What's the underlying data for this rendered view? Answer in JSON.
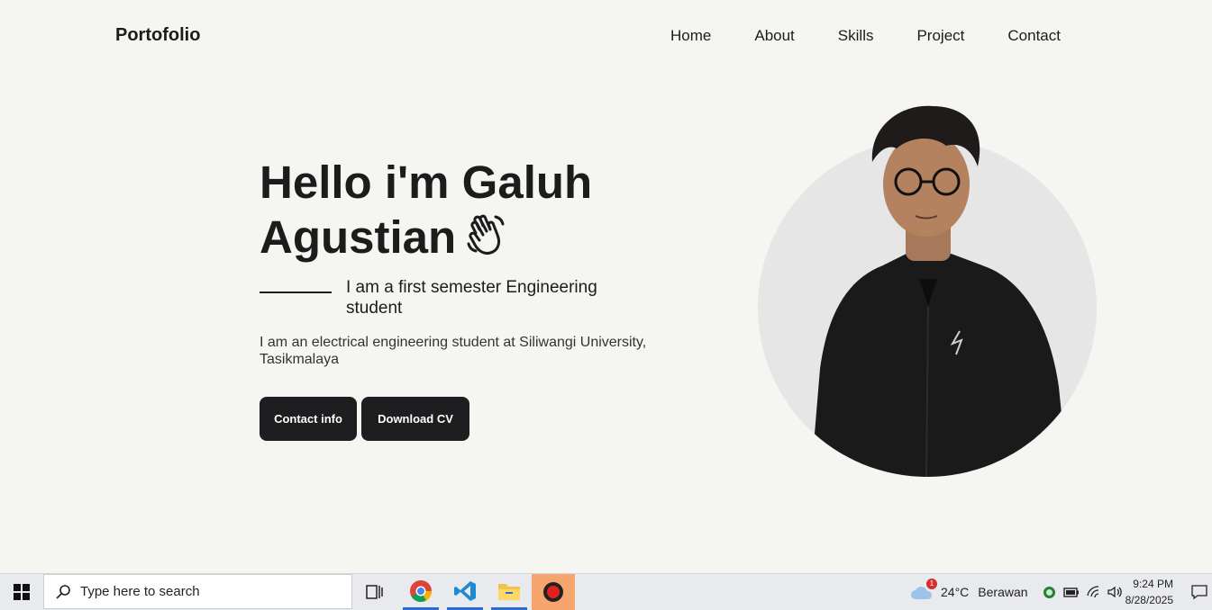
{
  "header": {
    "brand": "Portofolio",
    "nav": [
      "Home",
      "About",
      "Skills",
      "Project",
      "Contact"
    ]
  },
  "hero": {
    "title_line1": "Hello i'm Galuh",
    "title_line2": "Agustian",
    "subtitle": "I am a first semester Engineering student",
    "description": "I am an electrical engineering student at Siliwangi University, Tasikmalaya",
    "buttons": {
      "contact": "Contact info",
      "cv": "Download CV"
    }
  },
  "taskbar": {
    "search_placeholder": "Type here to search",
    "weather": {
      "temp": "24°C",
      "condition": "Berawan",
      "badge": "1"
    },
    "time": "9:24 PM",
    "date": "8/28/2025"
  },
  "colors": {
    "background": "#f5f5f2",
    "dark": "#1e1e20",
    "accent": "#2b6cd4"
  }
}
